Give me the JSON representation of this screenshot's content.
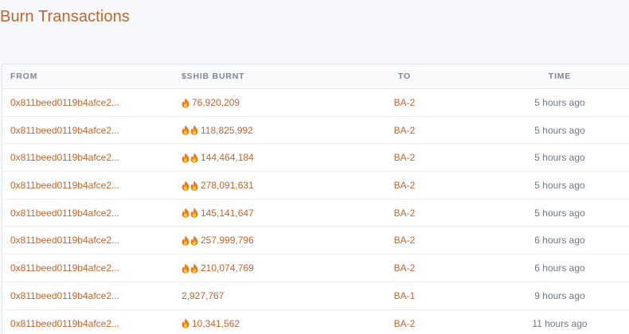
{
  "page_title": "Burn Transactions",
  "table": {
    "headers": {
      "from": "FROM",
      "burnt": "$SHIB BURNT",
      "to": "TO",
      "time": "TIME"
    },
    "rows": [
      {
        "from": "0x811beed0119b4afce2...",
        "flames": 1,
        "amount": "76,920,209",
        "to": "BA-2",
        "time": "5 hours ago"
      },
      {
        "from": "0x811beed0119b4afce2...",
        "flames": 2,
        "amount": "118,825,992",
        "to": "BA-2",
        "time": "5 hours ago"
      },
      {
        "from": "0x811beed0119b4afce2...",
        "flames": 2,
        "amount": "144,464,184",
        "to": "BA-2",
        "time": "5 hours ago"
      },
      {
        "from": "0x811beed0119b4afce2...",
        "flames": 2,
        "amount": "278,091,631",
        "to": "BA-2",
        "time": "5 hours ago"
      },
      {
        "from": "0x811beed0119b4afce2...",
        "flames": 2,
        "amount": "145,141,647",
        "to": "BA-2",
        "time": "5 hours ago"
      },
      {
        "from": "0x811beed0119b4afce2...",
        "flames": 2,
        "amount": "257,999,796",
        "to": "BA-2",
        "time": "6 hours ago"
      },
      {
        "from": "0x811beed0119b4afce2...",
        "flames": 2,
        "amount": "210,074,769",
        "to": "BA-2",
        "time": "6 hours ago"
      },
      {
        "from": "0x811beed0119b4afce2...",
        "flames": 0,
        "amount": "2,927,767",
        "to": "BA-1",
        "time": "9 hours ago"
      },
      {
        "from": "0x811beed0119b4afce2...",
        "flames": 1,
        "amount": "10,341,562",
        "to": "BA-2",
        "time": "11 hours ago"
      }
    ]
  },
  "icons": {
    "flame": "fire-icon"
  },
  "colors": {
    "accent": "#c0662c",
    "header_text": "#7d8596",
    "time_text": "#6f7787"
  }
}
